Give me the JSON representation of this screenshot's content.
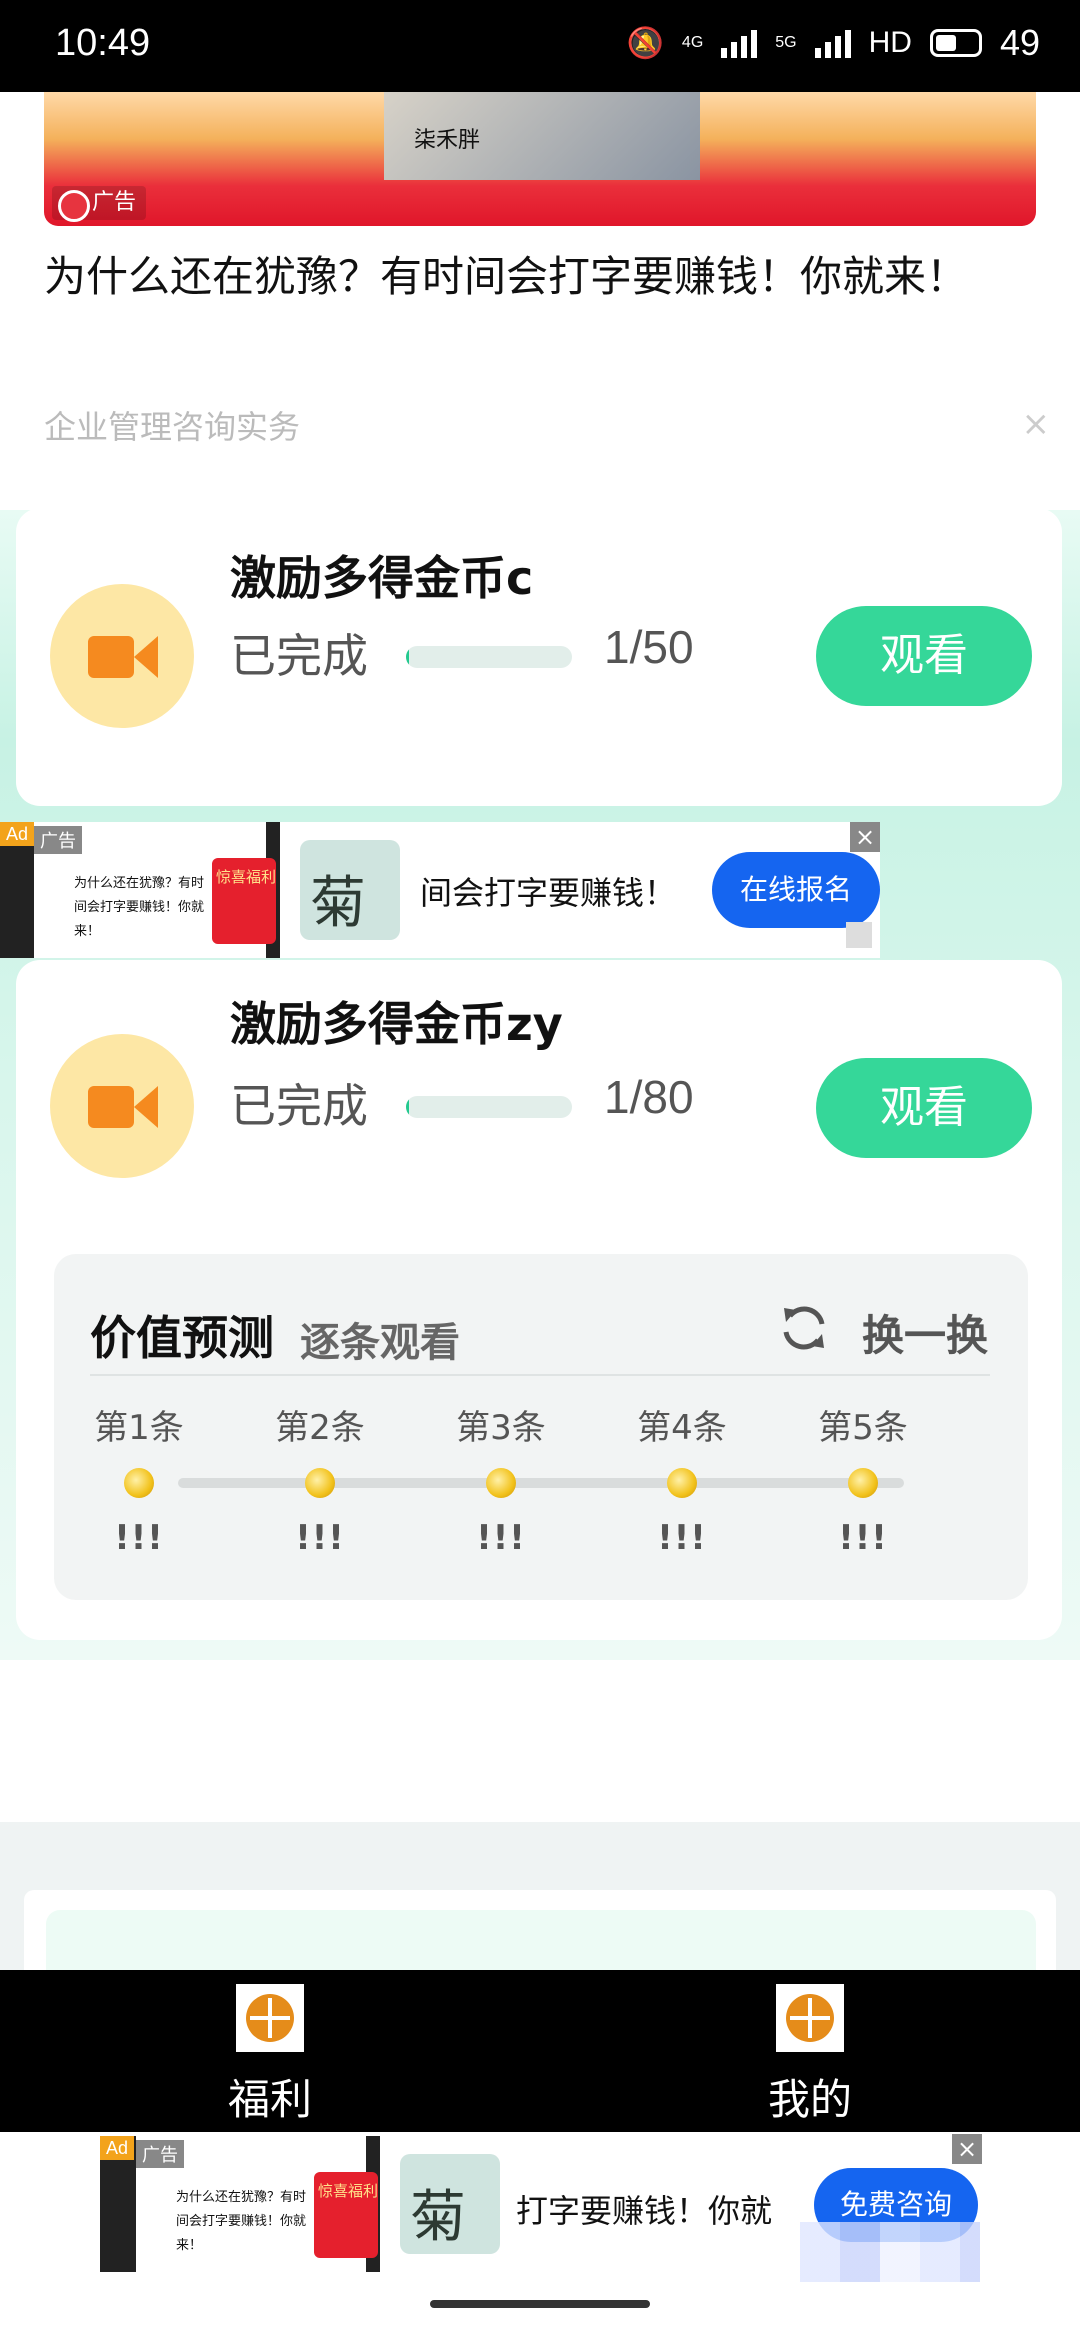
{
  "status_bar": {
    "time": "10:49",
    "network_4g": "4G",
    "network_5g": "5G",
    "hd": "HD",
    "battery": "49"
  },
  "top_ad": {
    "banner_photo_text": "柒禾胖",
    "ad_tag": "广告",
    "headline": "为什么还在犹豫？有时间会打字要赚钱！你就来！",
    "advertiser": "企业管理咨询实务",
    "close": "×"
  },
  "tasks": [
    {
      "title": "激励多得金币c",
      "status": "已完成",
      "count": "1/50",
      "progress": 0.02,
      "button": "观看"
    },
    {
      "title": "激励多得金币zy",
      "status": "已完成",
      "count": "1/80",
      "progress": 0.0125,
      "button": "观看"
    }
  ],
  "inline_ad": {
    "ad_badge": "Ad",
    "ad_tag": "广告",
    "thumb_text": "为什么还在犹豫？有时间会打字要赚钱！你就来！",
    "thumb_red_text": "惊喜福利",
    "logo_char": "菊",
    "scroll_text": "间会打字要赚钱！",
    "cta": "在线报名",
    "close": "×"
  },
  "predict": {
    "title": "价值预测",
    "subtitle": "逐条观看",
    "refresh": "换一换",
    "items": [
      {
        "label": "第1条",
        "value": "!!!"
      },
      {
        "label": "第2条",
        "value": "!!!"
      },
      {
        "label": "第3条",
        "value": "!!!"
      },
      {
        "label": "第4条",
        "value": "!!!"
      },
      {
        "label": "第5条",
        "value": "!!!"
      }
    ]
  },
  "bottom_nav": [
    {
      "label": "福利",
      "icon": "app-logo-icon"
    },
    {
      "label": "我的",
      "icon": "app-logo-icon"
    }
  ],
  "bottom_ad": {
    "ad_badge": "Ad",
    "ad_tag": "广告",
    "thumb_text": "为什么还在犹豫？有时间会打字要赚钱！你就来！",
    "thumb_red_text": "惊喜福利",
    "logo_char": "菊",
    "scroll_text": "打字要赚钱！你就",
    "cta": "免费咨询",
    "close": "×"
  },
  "colors": {
    "accent_green": "#35d799",
    "icon_bg": "#fde7a5",
    "icon_orange": "#f58a1f",
    "cta_blue": "#1565f0"
  }
}
